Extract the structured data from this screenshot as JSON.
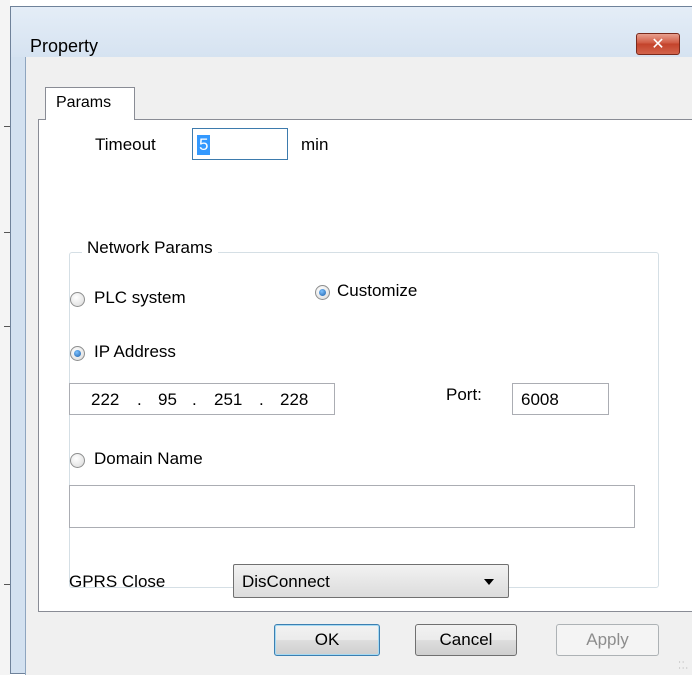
{
  "window": {
    "title": "Property",
    "close_icon": "close-icon"
  },
  "tabs": [
    {
      "label": "Params",
      "selected": true
    }
  ],
  "timeout": {
    "label": "Timeout",
    "value": "5",
    "unit": "min"
  },
  "network": {
    "group_label": "Network Params",
    "plc_system": {
      "label": "PLC system",
      "checked": false
    },
    "customize": {
      "label": "Customize",
      "checked": true
    },
    "ip_address": {
      "label": "IP Address",
      "checked": true,
      "octets": [
        "222",
        "95",
        "251",
        "228"
      ]
    },
    "port": {
      "label": "Port:",
      "value": "6008"
    },
    "domain_name": {
      "label": "Domain Name",
      "checked": false,
      "value": ""
    },
    "gprs_close": {
      "label": "GPRS Close",
      "selected": "DisConnect"
    }
  },
  "buttons": {
    "ok": "OK",
    "cancel": "Cancel",
    "apply": "Apply"
  },
  "colors": {
    "accent": "#3399ff",
    "close_button": "#c3432b",
    "title_bar": "#d6e3f1"
  }
}
